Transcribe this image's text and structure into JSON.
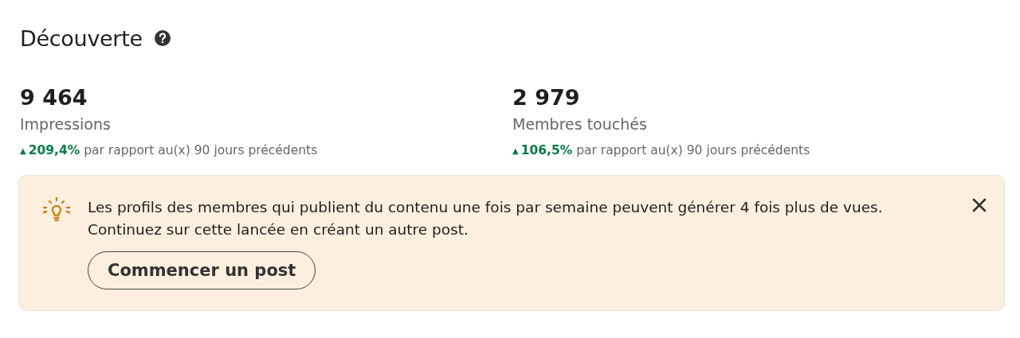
{
  "section": {
    "title": "Découverte",
    "help": true
  },
  "metrics": [
    {
      "value": "9 464",
      "label": "Impressions",
      "arrow": "▲",
      "change": "**209,4%** par rapport au(x) 90 jours précédents"
    },
    {
      "value": "2 979",
      "label": "Membres touchés",
      "arrow": "▲",
      "change": "**106,5%** par rapport au(x) 90 jours précédents"
    }
  ],
  "tip": {
    "message": "Les profils des membres qui publient du contenu une fois par semaine peuvent générer 4 fois plus de vues. Continuez sur cette lancée en créant un autre post.",
    "button": "Commencer un post",
    "dismissible": true
  }
}
